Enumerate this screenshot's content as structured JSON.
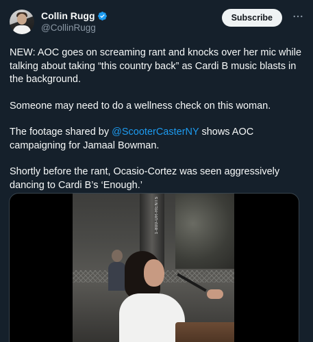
{
  "author": {
    "display_name": "Collin Rugg",
    "handle": "@CollinRugg",
    "verified": true,
    "verified_color": "#1d9bf0"
  },
  "actions": {
    "subscribe_label": "Subscribe",
    "more_icon": "more-horizontal-icon"
  },
  "tweet": {
    "p1": "NEW: AOC goes on screaming rant and knocks over her mic while talking about taking “this country back” as Cardi B music blasts in the background.",
    "p2": "Someone may need to do a wellness check on this woman.",
    "p3_before": "The footage shared by ",
    "p3_mention": "@ScooterCasterNY",
    "p3_after": " shows AOC campaigning for Jamaal Bowman.",
    "p4": "Shortly before the rant, Ocasio-Cortez was seen aggressively dancing to Cardi B’s ‘Enough.’"
  },
  "media": {
    "type": "video",
    "scaffold_text": "1-800-UR-RENTS"
  },
  "colors": {
    "background": "#15202b",
    "text": "#f7f9f9",
    "secondary": "#8b98a5",
    "link": "#1d9bf0"
  }
}
